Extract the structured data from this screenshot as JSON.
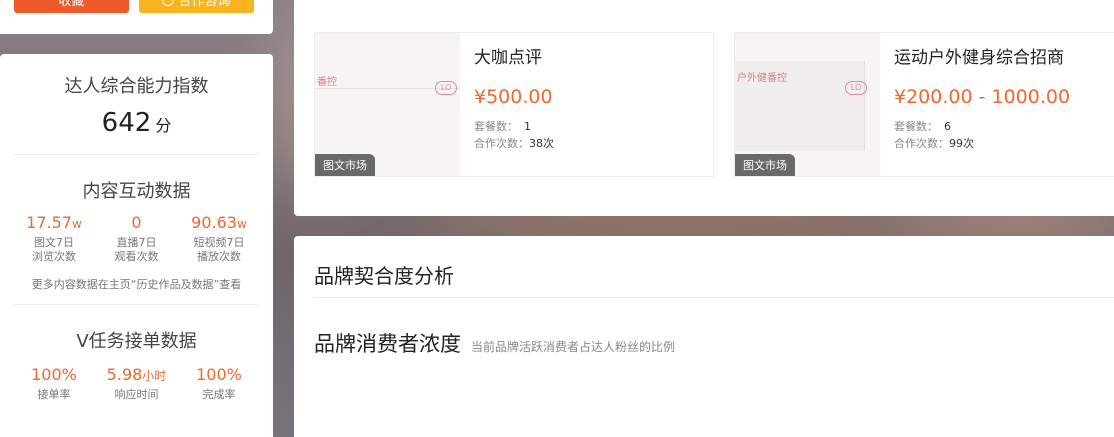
{
  "top_buttons": {
    "orange_label": "收藏",
    "yellow_label": "合作咨询"
  },
  "ability": {
    "title": "达人综合能力指数",
    "score": "642",
    "unit": "分"
  },
  "content_interaction": {
    "title": "内容互动数据",
    "stats": [
      {
        "value": "17.57",
        "suffix": "w",
        "label1": "图文7日",
        "label2": "浏览次数"
      },
      {
        "value": "0",
        "suffix": "",
        "label1": "直播7日",
        "label2": "观看次数"
      },
      {
        "value": "90.63",
        "suffix": "w",
        "label1": "短视频7日",
        "label2": "播放次数"
      }
    ],
    "note": "更多内容数据在主页“历史作品及数据”查看"
  },
  "task_data": {
    "title": "V任务接单数据",
    "stats": [
      {
        "value": "100%",
        "suffix": "",
        "label": "接单率"
      },
      {
        "value": "5.98",
        "suffix": "小时",
        "label": "响应时间"
      },
      {
        "value": "100%",
        "suffix": "",
        "label": "完成率"
      }
    ]
  },
  "products": [
    {
      "name": "大咖点评",
      "price": "¥500.00",
      "packages_label": "套餐数：",
      "packages_value": "1",
      "coop_label": "合作次数：",
      "coop_value": "38次",
      "badge": "图文市场",
      "thumb_text": "番控",
      "thumb_logo": "LO"
    },
    {
      "name": "运动户外健身综合招商",
      "price": "¥200.00 - 1000.00",
      "packages_label": "套餐数：",
      "packages_value": "6",
      "coop_label": "合作次数：",
      "coop_value": "99次",
      "badge": "图文市场",
      "thumb_text": "户外健番控",
      "thumb_logo": "LO"
    }
  ],
  "brand_fit": {
    "title": "品牌契合度分析",
    "sub_title": "品牌消费者浓度",
    "sub_desc": "当前品牌活跃消费者占达人粉丝的比例"
  },
  "colors": {
    "accent": "#f0682d",
    "orange_button": "#f05a2a",
    "yellow_button": "#f8b521"
  }
}
